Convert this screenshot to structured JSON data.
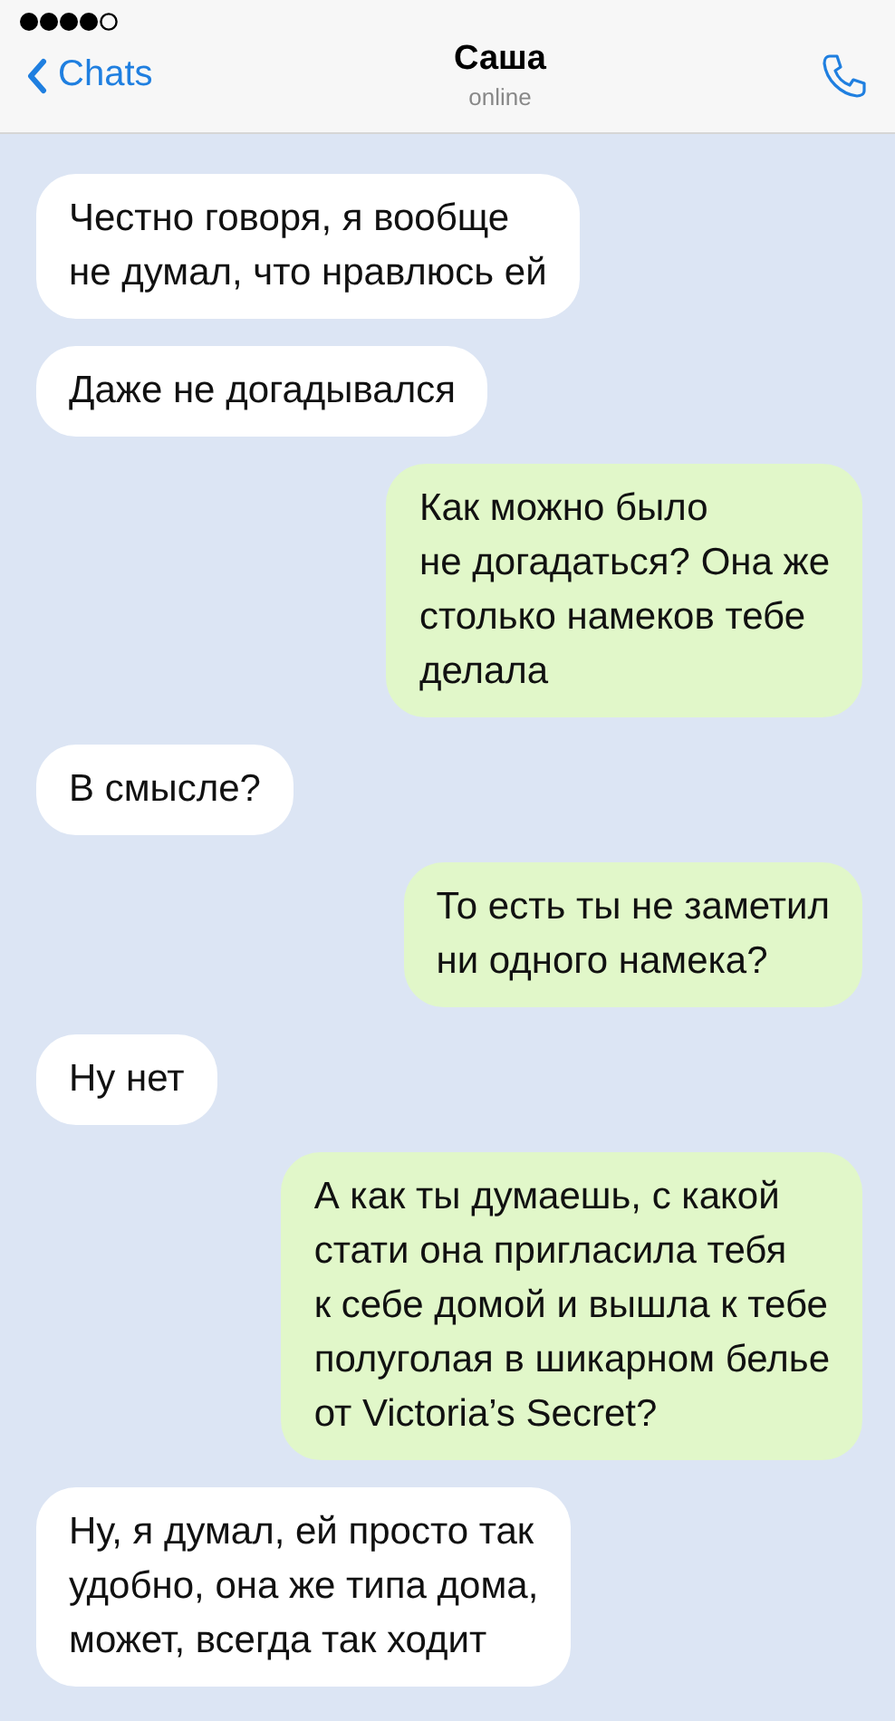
{
  "header": {
    "back_label": "Chats",
    "title": "Саша",
    "status": "online"
  },
  "messages": [
    {
      "kind": "incoming",
      "text": "Честно говоря, я вообще\nне думал, что нравлюсь ей"
    },
    {
      "kind": "incoming",
      "text": "Даже не догадывался"
    },
    {
      "kind": "outgoing",
      "text": "Как можно было\nне догадаться? Она же\nстолько намеков тебе\nделала"
    },
    {
      "kind": "incoming",
      "text": "В смысле?"
    },
    {
      "kind": "outgoing",
      "text": "То есть ты не заметил\nни одного намека?"
    },
    {
      "kind": "incoming",
      "text": "Ну нет"
    },
    {
      "kind": "outgoing",
      "text": "А как ты думаешь, с какой\nстати она пригласила тебя\nк себе домой и вышла к тебе\nполуголая в шикарном белье\nот Victoria’s Secret?"
    },
    {
      "kind": "incoming",
      "text": "Ну, я думал, ей просто так\nудобно, она же типа дома,\nможет, всегда так ходит"
    }
  ]
}
